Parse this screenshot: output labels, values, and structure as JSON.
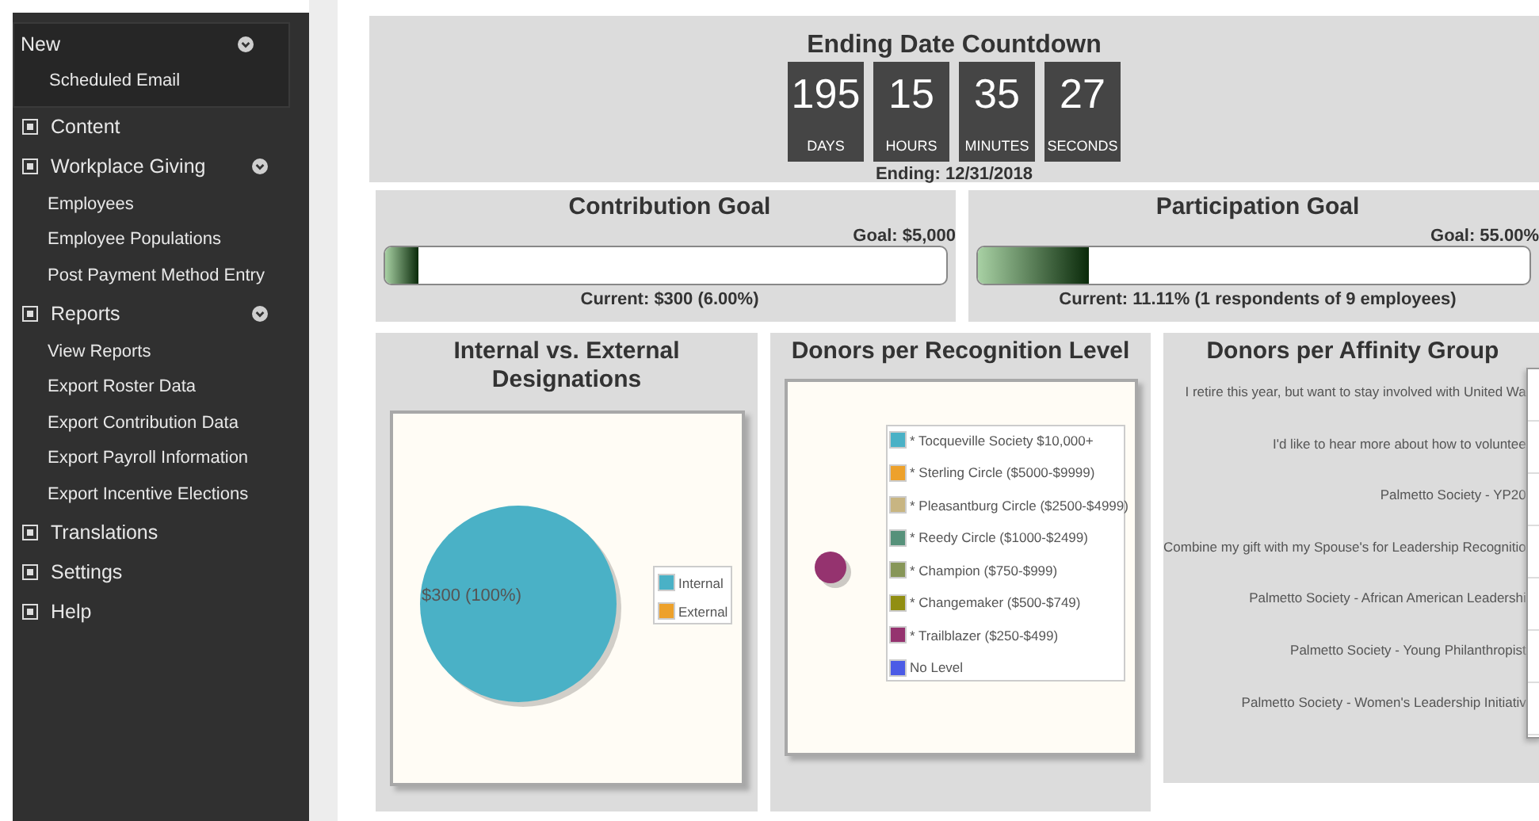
{
  "sidebar": {
    "items": [
      {
        "kind": "panel",
        "label": "New",
        "expanded": true,
        "children": [
          {
            "label": "Scheduled Email"
          }
        ]
      },
      {
        "kind": "section",
        "label": "Content",
        "expanded": false
      },
      {
        "kind": "section",
        "label": "Workplace Giving",
        "expanded": true,
        "children": [
          {
            "label": "Employees"
          },
          {
            "label": "Employee Populations"
          },
          {
            "label": "Post Payment Method Entry"
          }
        ]
      },
      {
        "kind": "section",
        "label": "Reports",
        "expanded": true,
        "children": [
          {
            "label": "View Reports"
          },
          {
            "label": "Export Roster Data"
          },
          {
            "label": "Export Contribution Data"
          },
          {
            "label": "Export Payroll Information"
          },
          {
            "label": "Export Incentive Elections"
          }
        ]
      },
      {
        "kind": "section",
        "label": "Translations",
        "expanded": false
      },
      {
        "kind": "section",
        "label": "Settings",
        "expanded": false
      },
      {
        "kind": "section",
        "label": "Help",
        "expanded": false
      }
    ]
  },
  "countdown": {
    "title": "Ending Date Countdown",
    "units": [
      {
        "value": "195",
        "label": "DAYS"
      },
      {
        "value": "15",
        "label": "HOURS"
      },
      {
        "value": "35",
        "label": "MINUTES"
      },
      {
        "value": "27",
        "label": "SECONDS"
      }
    ],
    "ending": "Ending: 12/31/2018"
  },
  "goals": [
    {
      "title": "Contribution Goal",
      "goal": "Goal: $5,000",
      "level": 0.06,
      "current": "Current: $300 (6.00%)"
    },
    {
      "title": "Participation Goal",
      "goal": "Goal: 55.00%",
      "level": 0.2,
      "current": "Current: 11.11% (1 respondents of 9 employees)"
    }
  ],
  "designations": {
    "title": "Internal vs. External Designations",
    "slice_label": "$300 (100%)",
    "legend": [
      {
        "label": "Internal",
        "color": "#4ab1c6"
      },
      {
        "label": "External",
        "color": "#eda12b"
      }
    ]
  },
  "recognition": {
    "title": "Donors per Recognition Level",
    "legend": [
      {
        "label": "* Tocqueville Society $10,000+",
        "color": "#4ab1c6"
      },
      {
        "label": "* Sterling Circle ($5000-$9999)",
        "color": "#eda12b"
      },
      {
        "label": "* Pleasantburg Circle ($2500-$4999)",
        "color": "#c8b582"
      },
      {
        "label": "* Reedy Circle ($1000-$2499)",
        "color": "#56917a"
      },
      {
        "label": "* Champion ($750-$999)",
        "color": "#879658"
      },
      {
        "label": "* Changemaker ($500-$749)",
        "color": "#918e12"
      },
      {
        "label": "* Trailblazer ($250-$499)",
        "color": "#95336f"
      },
      {
        "label": "No Level",
        "color": "#4b5be6"
      }
    ]
  },
  "affinity": {
    "title": "Donors per Affinity Group",
    "labels": [
      "I retire this year, but want to stay involved with United Wa",
      "I'd like to hear more about how to voluntee",
      "Palmetto Society - YP20",
      "Combine my gift with my Spouse's for Leadership Recognitio",
      "Palmetto Society - African American Leadershi",
      "Palmetto Society - Young Philanthropist",
      "Palmetto Society - Women's Leadership Initiativ"
    ]
  }
}
